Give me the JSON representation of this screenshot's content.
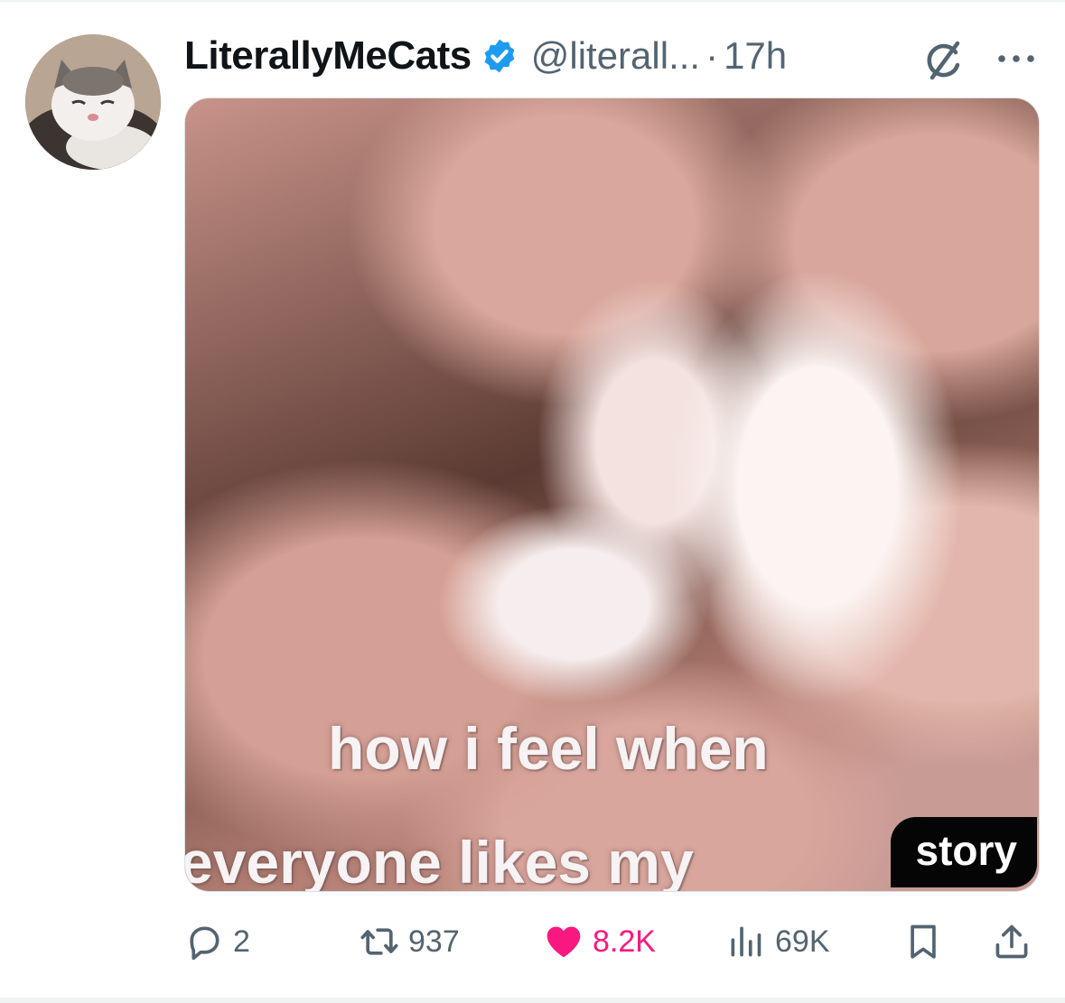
{
  "post": {
    "author": {
      "display_name": "LiterallyMeCats",
      "handle": "@literall...",
      "verified": true,
      "timestamp": "17h",
      "separator": "·"
    },
    "media": {
      "caption_line_1": "how i feel when",
      "caption_line_2": "everyone likes my",
      "badge": "story"
    },
    "actions": {
      "replies": "2",
      "reposts": "937",
      "likes": "8.2K",
      "views": "69K",
      "liked": true
    }
  },
  "icons": {
    "verified": "verified-badge-icon",
    "grok": "grok-icon",
    "more": "more-icon",
    "reply": "reply-icon",
    "repost": "repost-icon",
    "like": "heart-icon",
    "views": "views-icon",
    "bookmark": "bookmark-icon",
    "share": "share-icon"
  },
  "colors": {
    "verified_blue": "#1d9bf0",
    "like_pink": "#f91880",
    "secondary_text": "#536471"
  }
}
